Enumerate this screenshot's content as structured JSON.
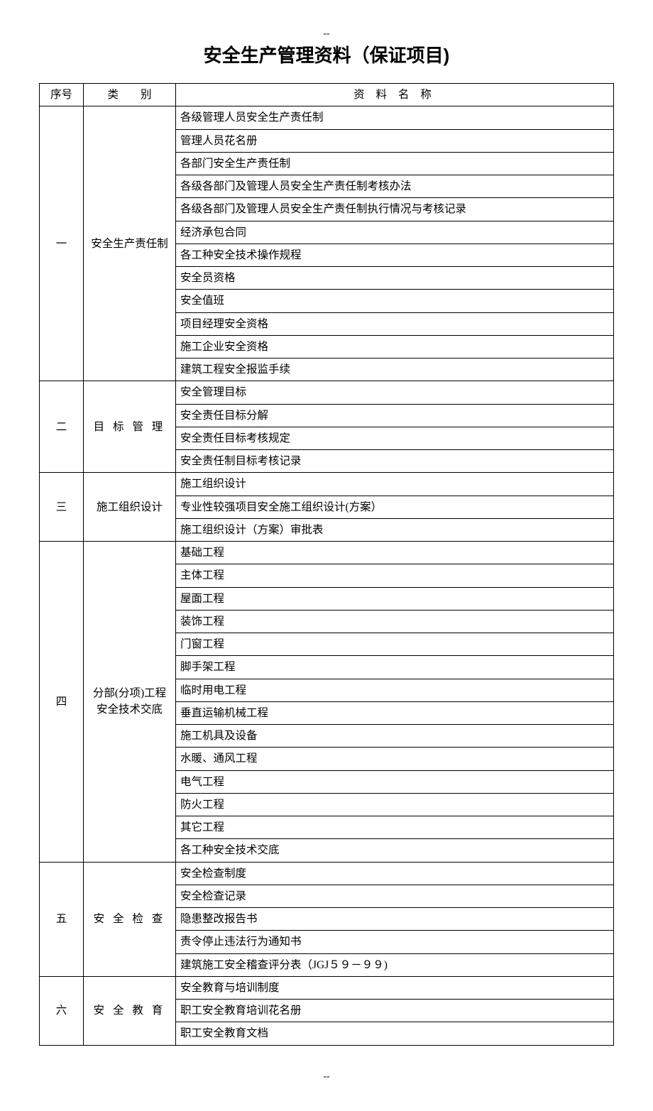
{
  "header_mark": "--",
  "title": "安全生产管理资料（保证项目)",
  "footer_mark": "--",
  "columns": {
    "seq": "序号",
    "category": "类　　别",
    "name": "资 料 名 称"
  },
  "sections": [
    {
      "seq": "一",
      "category": "安全生产责任制",
      "cat_spacing": "",
      "items": [
        "各级管理人员安全生产责任制",
        "管理人员花名册",
        "各部门安全生产责任制",
        "各级各部门及管理人员安全生产责任制考核办法",
        "各级各部门及管理人员安全生产责任制执行情况与考核记录",
        "经济承包合同",
        "各工种安全技术操作规程",
        "安全员资格",
        "安全值班",
        "项目经理安全资格",
        "施工企业安全资格",
        "建筑工程安全报监手续"
      ]
    },
    {
      "seq": "二",
      "category": "目 标 管 理",
      "cat_spacing": "sp-med",
      "items": [
        "安全管理目标",
        "安全责任目标分解",
        "安全责任目标考核规定",
        "安全责任制目标考核记录"
      ]
    },
    {
      "seq": "三",
      "category": "施工组织设计",
      "cat_spacing": "",
      "items": [
        "施工组织设计",
        "专业性较强项目安全施工组织设计(方案）",
        "施工组织设计（方案）审批表"
      ]
    },
    {
      "seq": "四",
      "category": "分部(分项)工程安全技术交底",
      "cat_spacing": "",
      "items": [
        "基础工程",
        "主体工程",
        "屋面工程",
        "装饰工程",
        "门窗工程",
        "脚手架工程",
        "临时用电工程",
        "垂直运输机械工程",
        "施工机具及设备",
        "水暖、通风工程",
        "电气工程",
        "防火工程",
        "其它工程",
        "各工种安全技术交底"
      ]
    },
    {
      "seq": "五",
      "category": "安 全 检 查",
      "cat_spacing": "sp-med",
      "items": [
        "安全检查制度",
        "安全检查记录",
        "隐患整改报告书",
        "责令停止违法行为通知书",
        "建筑施工安全稽查评分表（JGJ５９－９９)"
      ]
    },
    {
      "seq": "六",
      "category": "安 全 教 育",
      "cat_spacing": "sp-med",
      "items": [
        "安全教育与培训制度",
        "职工安全教育培训花名册",
        "职工安全教育文档"
      ]
    }
  ]
}
